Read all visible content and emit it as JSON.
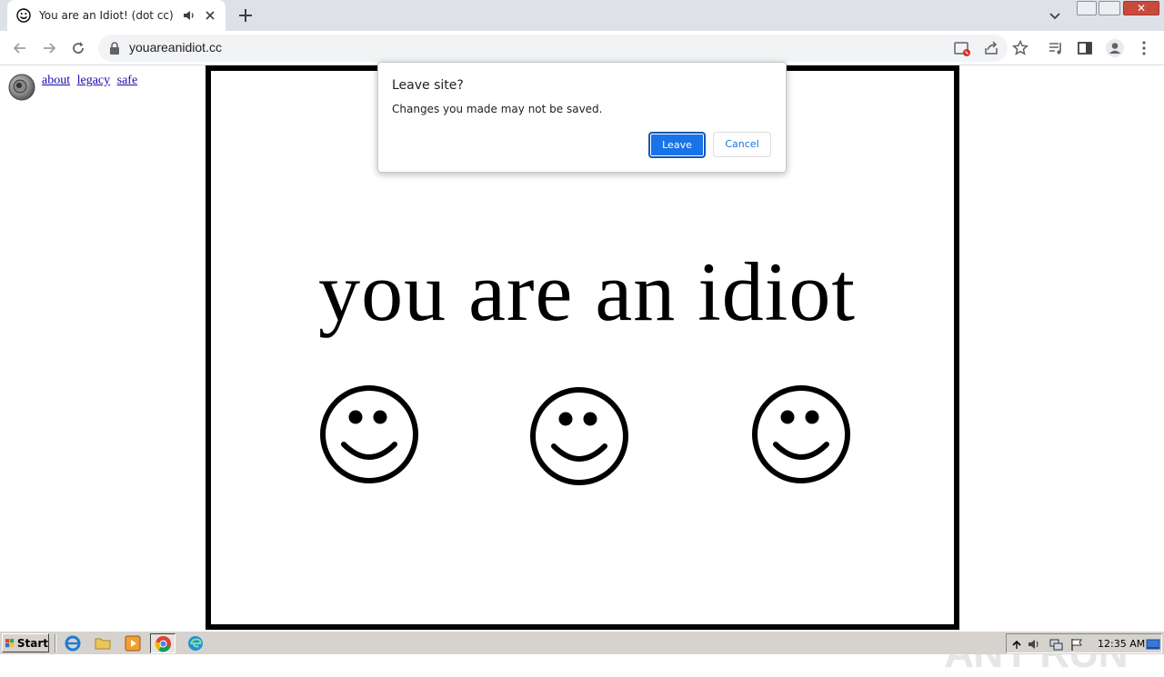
{
  "browser": {
    "tab_title": "You are an Idiot! (dot cc)",
    "url": "youareanidiot.cc"
  },
  "page": {
    "links": [
      "about",
      "legacy",
      "safe"
    ],
    "headline": "you are an idiot",
    "smiley_count": 3
  },
  "dialog": {
    "title": "Leave site?",
    "message": "Changes you made may not be saved.",
    "leave_label": "Leave",
    "cancel_label": "Cancel"
  },
  "watermark": {
    "text": "ANY RUN"
  },
  "taskbar": {
    "start_label": "Start",
    "clock": "12:35 AM",
    "quick_launch": [
      "ie-icon",
      "explorer-folder-icon",
      "media-player-icon",
      "chrome-icon",
      "edge-icon"
    ]
  },
  "colors": {
    "accent": "#1a73e8",
    "tabstrip": "#dee1e6",
    "taskbar": "#d6d3ce"
  }
}
